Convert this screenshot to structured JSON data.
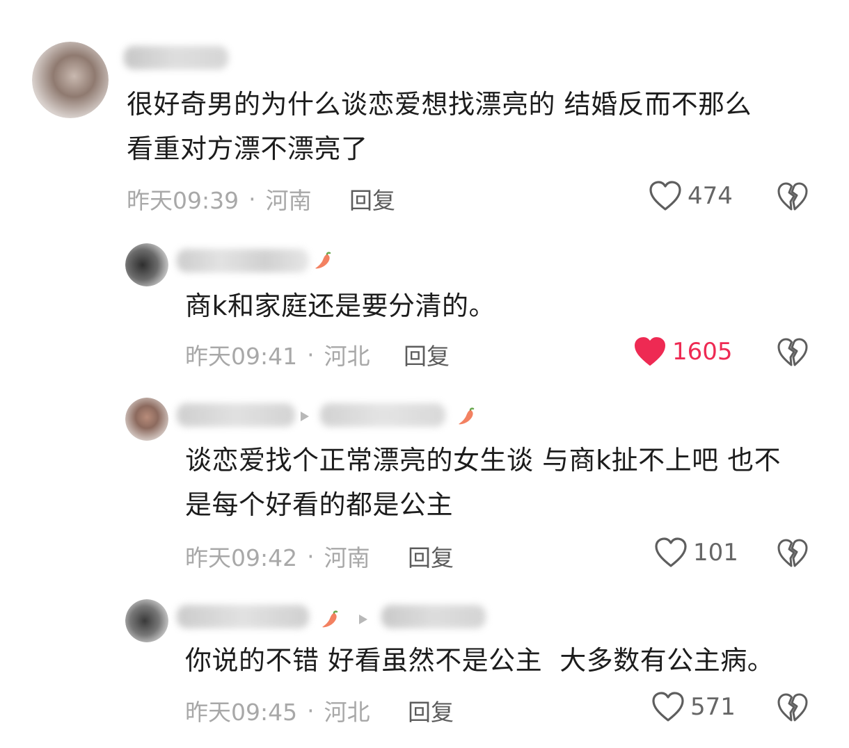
{
  "comments": [
    {
      "text": "很好奇男的为什么谈恋爱想找漂亮的 结婚反而不那么\n看重对方漂不漂亮了",
      "time": "昨天09:39",
      "location": "河南",
      "reply_label": "回复",
      "likes": "474",
      "liked": false
    },
    {
      "text": "商k和家庭还是要分清的。",
      "time": "昨天09:41",
      "location": "河北",
      "reply_label": "回复",
      "likes": "1605",
      "liked": true
    },
    {
      "text": "谈恋爱找个正常漂亮的女生谈 与商k扯不上吧 也不\n是每个好看的都是公主",
      "time": "昨天09:42",
      "location": "河南",
      "reply_label": "回复",
      "likes": "101",
      "liked": false
    },
    {
      "text": "你说的不错 好看虽然不是公主  大多数有公主病。",
      "time": "昨天09:45",
      "location": "河北",
      "reply_label": "回复",
      "likes": "571",
      "liked": false
    }
  ],
  "separator": "·",
  "colors": {
    "liked": "#ee2a53",
    "meta": "#a8a8a8",
    "text": "#1c1c1c"
  },
  "icons": [
    "heart-icon",
    "broken-heart-icon",
    "chili-icon",
    "reply-arrow-icon"
  ]
}
